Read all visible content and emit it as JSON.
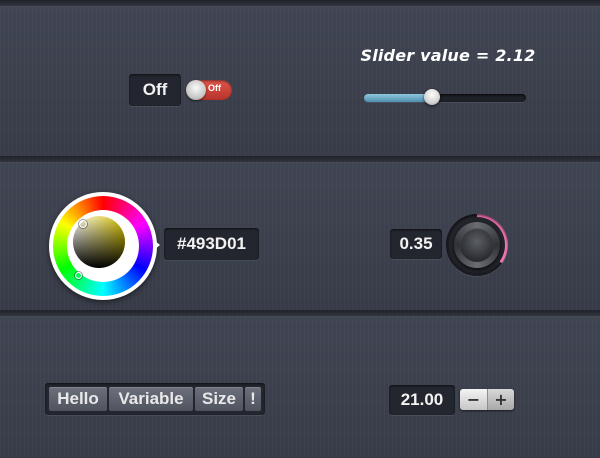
{
  "toggle_row": {
    "label": "Off",
    "switch_text": "Off",
    "state": "off"
  },
  "slider": {
    "title": "Slider value = 2.12",
    "value": 2.12,
    "fill_fraction": 0.42
  },
  "color_picker": {
    "hex": "#493D01"
  },
  "knob": {
    "value_text": "0.35",
    "value": 0.35
  },
  "segments": {
    "items": [
      "Hello",
      "Variable",
      "Size",
      "!"
    ]
  },
  "stepper": {
    "value_text": "21.00",
    "minus_label": "−",
    "plus_label": "+"
  },
  "colors": {
    "background": "#3a3e4b",
    "toggle_off": "#c63b32",
    "slider_fill": "#6fb0cf",
    "knob_accent": "#ef76b3"
  }
}
